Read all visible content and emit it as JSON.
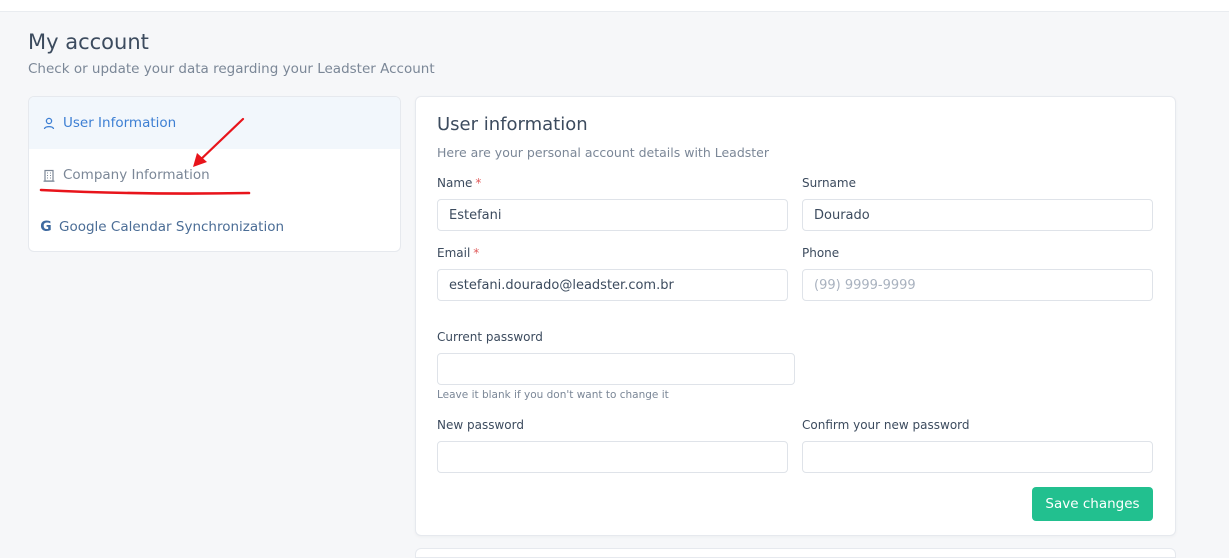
{
  "header": {
    "title": "My account",
    "subtitle": "Check or update your data regarding your Leadster Account"
  },
  "sidebar": {
    "items": [
      {
        "label": "User Information",
        "icon": "user-icon",
        "active": true
      },
      {
        "label": "Company Information",
        "icon": "building-icon",
        "active": false
      },
      {
        "label": "Google Calendar Synchronization",
        "icon": "google-icon",
        "active": false
      }
    ]
  },
  "form": {
    "title": "User information",
    "subtitle": "Here are your personal account details with Leadster",
    "name": {
      "label": "Name",
      "required_mark": "*",
      "value": "Estefani"
    },
    "surname": {
      "label": "Surname",
      "value": "Dourado"
    },
    "email": {
      "label": "Email",
      "required_mark": "*",
      "value": "estefani.dourado@leadster.com.br"
    },
    "phone": {
      "label": "Phone",
      "value": "",
      "placeholder": "(99) 9999-9999"
    },
    "current_password": {
      "label": "Current password",
      "value": "",
      "hint": "Leave it blank if you don't want to change it"
    },
    "new_password": {
      "label": "New password",
      "value": ""
    },
    "confirm_password": {
      "label": "Confirm your new password",
      "value": ""
    },
    "save_label": "Save changes"
  },
  "colors": {
    "accent_blue": "#3d7fd3",
    "save_green": "#22c08f",
    "required_red": "#e05a5a",
    "annotation_red": "#e8141b"
  }
}
